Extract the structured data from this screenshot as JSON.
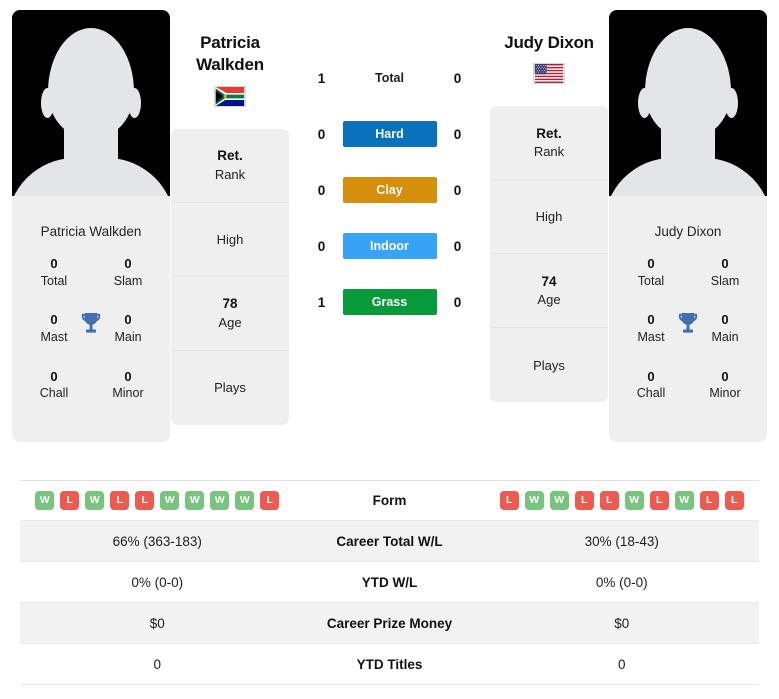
{
  "players": {
    "left": {
      "name_lines": [
        "Patricia",
        "Walkden"
      ],
      "full_name": "Patricia Walkden",
      "caption": "Patricia Walkden",
      "country": "South Africa",
      "flag": "za-flag-icon",
      "age": "78",
      "trophies": [
        {
          "num": "0",
          "label": "Total"
        },
        {
          "num": "0",
          "label": "Slam"
        },
        {
          "num": "0",
          "label": "Mast"
        },
        {
          "num": "0",
          "label": "Main"
        },
        {
          "num": "0",
          "label": "Chall"
        },
        {
          "num": "0",
          "label": "Minor"
        }
      ],
      "form": [
        "W",
        "L",
        "W",
        "L",
        "L",
        "W",
        "W",
        "W",
        "W",
        "L"
      ],
      "career_total_wl": "66% (363-183)",
      "ytd_wl": "0% (0-0)",
      "career_prize_money": "$0",
      "ytd_titles": "0"
    },
    "right": {
      "name_lines": [
        "Judy Dixon"
      ],
      "full_name": "Judy Dixon",
      "caption": "Judy Dixon",
      "country": "United States",
      "flag": "us-flag-icon",
      "age": "74",
      "trophies": [
        {
          "num": "0",
          "label": "Total"
        },
        {
          "num": "0",
          "label": "Slam"
        },
        {
          "num": "0",
          "label": "Mast"
        },
        {
          "num": "0",
          "label": "Main"
        },
        {
          "num": "0",
          "label": "Chall"
        },
        {
          "num": "0",
          "label": "Minor"
        }
      ],
      "form": [
        "L",
        "W",
        "W",
        "L",
        "L",
        "W",
        "L",
        "W",
        "L",
        "L"
      ],
      "career_total_wl": "30% (18-43)",
      "ytd_wl": "0% (0-0)",
      "career_prize_money": "$0",
      "ytd_titles": "0"
    }
  },
  "info_card": {
    "rank_value": "Ret.",
    "rank_label": "Rank",
    "high_label": "High",
    "age_label": "Age",
    "plays_label": "Plays"
  },
  "surfaces": [
    {
      "label": "Total",
      "left": "1",
      "right": "0",
      "color": "transparent",
      "plain": true
    },
    {
      "label": "Hard",
      "left": "0",
      "right": "0",
      "color": "#0871bb",
      "plain": false
    },
    {
      "label": "Clay",
      "left": "0",
      "right": "0",
      "color": "#d68f0b",
      "plain": false
    },
    {
      "label": "Indoor",
      "left": "0",
      "right": "0",
      "color": "#36a3f7",
      "plain": false
    },
    {
      "label": "Grass",
      "left": "1",
      "right": "0",
      "color": "#069a3b",
      "plain": false
    }
  ],
  "table_rows": [
    {
      "label": "Form",
      "type": "form"
    },
    {
      "label": "Career Total W/L",
      "type": "text",
      "left": "66% (363-183)",
      "right": "30% (18-43)"
    },
    {
      "label": "YTD W/L",
      "type": "text",
      "left": "0% (0-0)",
      "right": "0% (0-0)"
    },
    {
      "label": "Career Prize Money",
      "type": "text",
      "left": "$0",
      "right": "$0"
    },
    {
      "label": "YTD Titles",
      "type": "text",
      "left": "0",
      "right": "0"
    }
  ],
  "colors": {
    "hard": "#0871bb",
    "clay": "#d68f0b",
    "indoor": "#36a3f7",
    "grass": "#069a3b",
    "win_badge": "#76c47e",
    "loss_badge": "#ee5a4f",
    "card_bg": "#efefef",
    "trophy": "#3f6fb5"
  }
}
